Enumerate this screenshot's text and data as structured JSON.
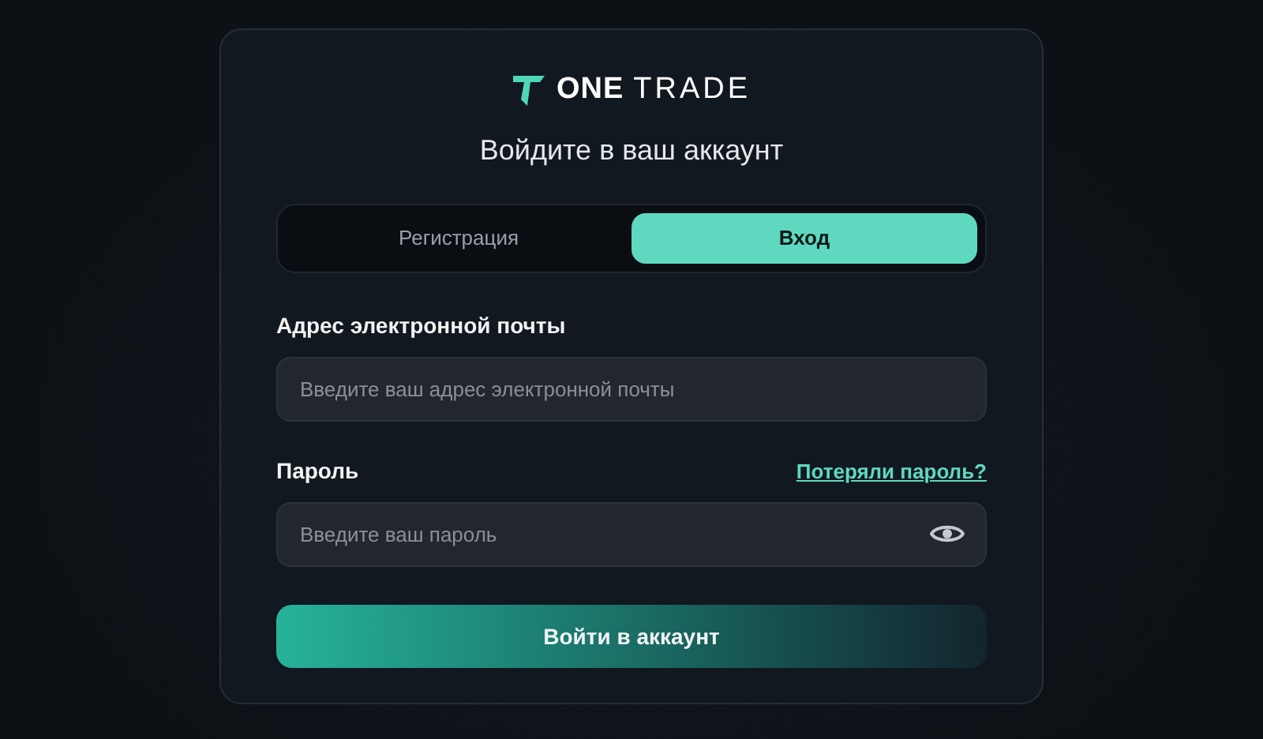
{
  "logo": {
    "bold": "ONE",
    "light": "TRADE"
  },
  "heading": "Войдите в ваш аккаунт",
  "tabs": [
    {
      "label": "Регистрация",
      "selected": false
    },
    {
      "label": "Вход",
      "selected": true
    }
  ],
  "email": {
    "label": "Адрес электронной почты",
    "placeholder": "Введите ваш адрес электронной почты"
  },
  "password": {
    "label": "Пароль",
    "forgot_link": "Потеряли пароль?",
    "placeholder": "Введите ваш пароль"
  },
  "submit": "Войти в аккаунт"
}
